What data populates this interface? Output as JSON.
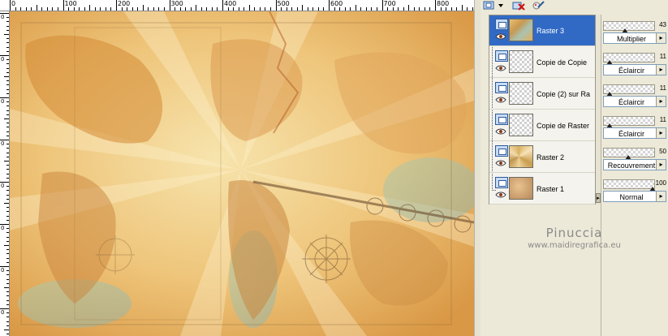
{
  "rulers": {
    "top_labels": [
      "0",
      "100",
      "200",
      "300",
      "400",
      "500",
      "600",
      "700",
      "800",
      "900"
    ],
    "left_labels": [
      "0",
      "0",
      "0",
      "0",
      "0",
      "0",
      "0",
      "0"
    ]
  },
  "toolbar": {
    "new_layer_icon": "layer-icon",
    "delete_layer_icon": "delete-icon",
    "edit_icon": "edit-icon"
  },
  "layers": [
    {
      "name": "Raster 3",
      "selected": true,
      "thumb": "map"
    },
    {
      "name": "Copie de Copie",
      "selected": false,
      "thumb": "checker"
    },
    {
      "name": "Copie (2) sur Ra",
      "selected": false,
      "thumb": "checker"
    },
    {
      "name": "Copie de Raster",
      "selected": false,
      "thumb": "checker"
    },
    {
      "name": "Raster 2",
      "selected": false,
      "thumb": "rays"
    },
    {
      "name": "Raster 1",
      "selected": false,
      "thumb": "blur"
    }
  ],
  "properties": [
    {
      "opacity": "43",
      "blend": "Multiplier"
    },
    {
      "opacity": "11",
      "blend": "Éclaircir"
    },
    {
      "opacity": "11",
      "blend": "Éclaircir"
    },
    {
      "opacity": "11",
      "blend": "Éclaircir"
    },
    {
      "opacity": "50",
      "blend": "Recouvrement"
    },
    {
      "opacity": "100",
      "blend": "Normal"
    }
  ],
  "watermark": {
    "title": "Pinuccia",
    "url": "www.maidiregrafica.eu"
  }
}
